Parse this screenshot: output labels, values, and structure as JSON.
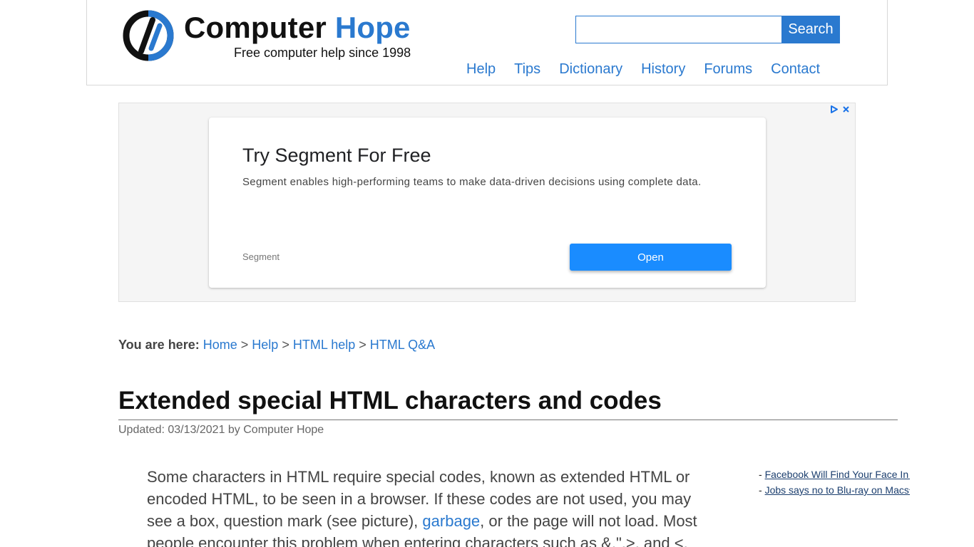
{
  "header": {
    "brand_main": "Computer",
    "brand_accent": "Hope",
    "tagline": "Free computer help since 1998",
    "search": {
      "value": "",
      "placeholder": "",
      "button": "Search"
    },
    "nav": [
      "Help",
      "Tips",
      "Dictionary",
      "History",
      "Forums",
      "Contact"
    ]
  },
  "ad": {
    "title": "Try Segment For Free",
    "text": "Segment enables high-performing teams to make data-driven decisions using complete data.",
    "sponsor": "Segment",
    "button": "Open"
  },
  "breadcrumb": {
    "prefix": "You are here:",
    "items": [
      "Home",
      "Help",
      "HTML help",
      "HTML Q&A"
    ],
    "separator": ">"
  },
  "article": {
    "title": "Extended special HTML characters and codes",
    "updated": "Updated: 03/13/2021 by Computer Hope",
    "para_before_link": "Some characters in HTML require special codes, known as extended HTML or encoded HTML, to be seen in a browser. If these codes are not used, you may see a box, question mark (see picture), ",
    "link": "garbage",
    "para_after_link": ", or the page will not load. Most people encounter this problem when entering characters such as &,\",>, and <."
  },
  "news": [
    "Facebook Will Find Your Face In T",
    "Jobs says no to Blu-ray on Macs�"
  ],
  "colors": {
    "accent": "#2a79cf",
    "ad_button": "#1a8cff"
  }
}
